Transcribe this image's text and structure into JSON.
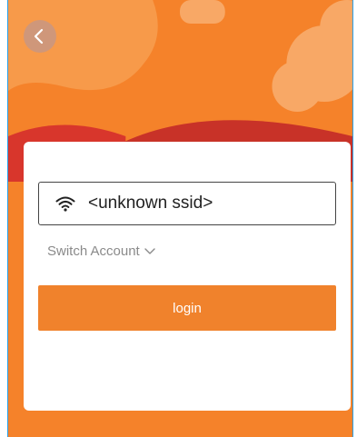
{
  "header": {
    "back_icon": "chevron-left-icon"
  },
  "login_card": {
    "ssid_icon": "wifi-icon",
    "ssid_value": "<unknown ssid>",
    "switch_account_label": "Switch Account",
    "switch_account_icon": "chevron-down-icon",
    "login_label": "login"
  },
  "colors": {
    "background": "#f5822a",
    "accent": "#f0822c",
    "card": "#ffffff",
    "muted_text": "#8a8a8a"
  }
}
